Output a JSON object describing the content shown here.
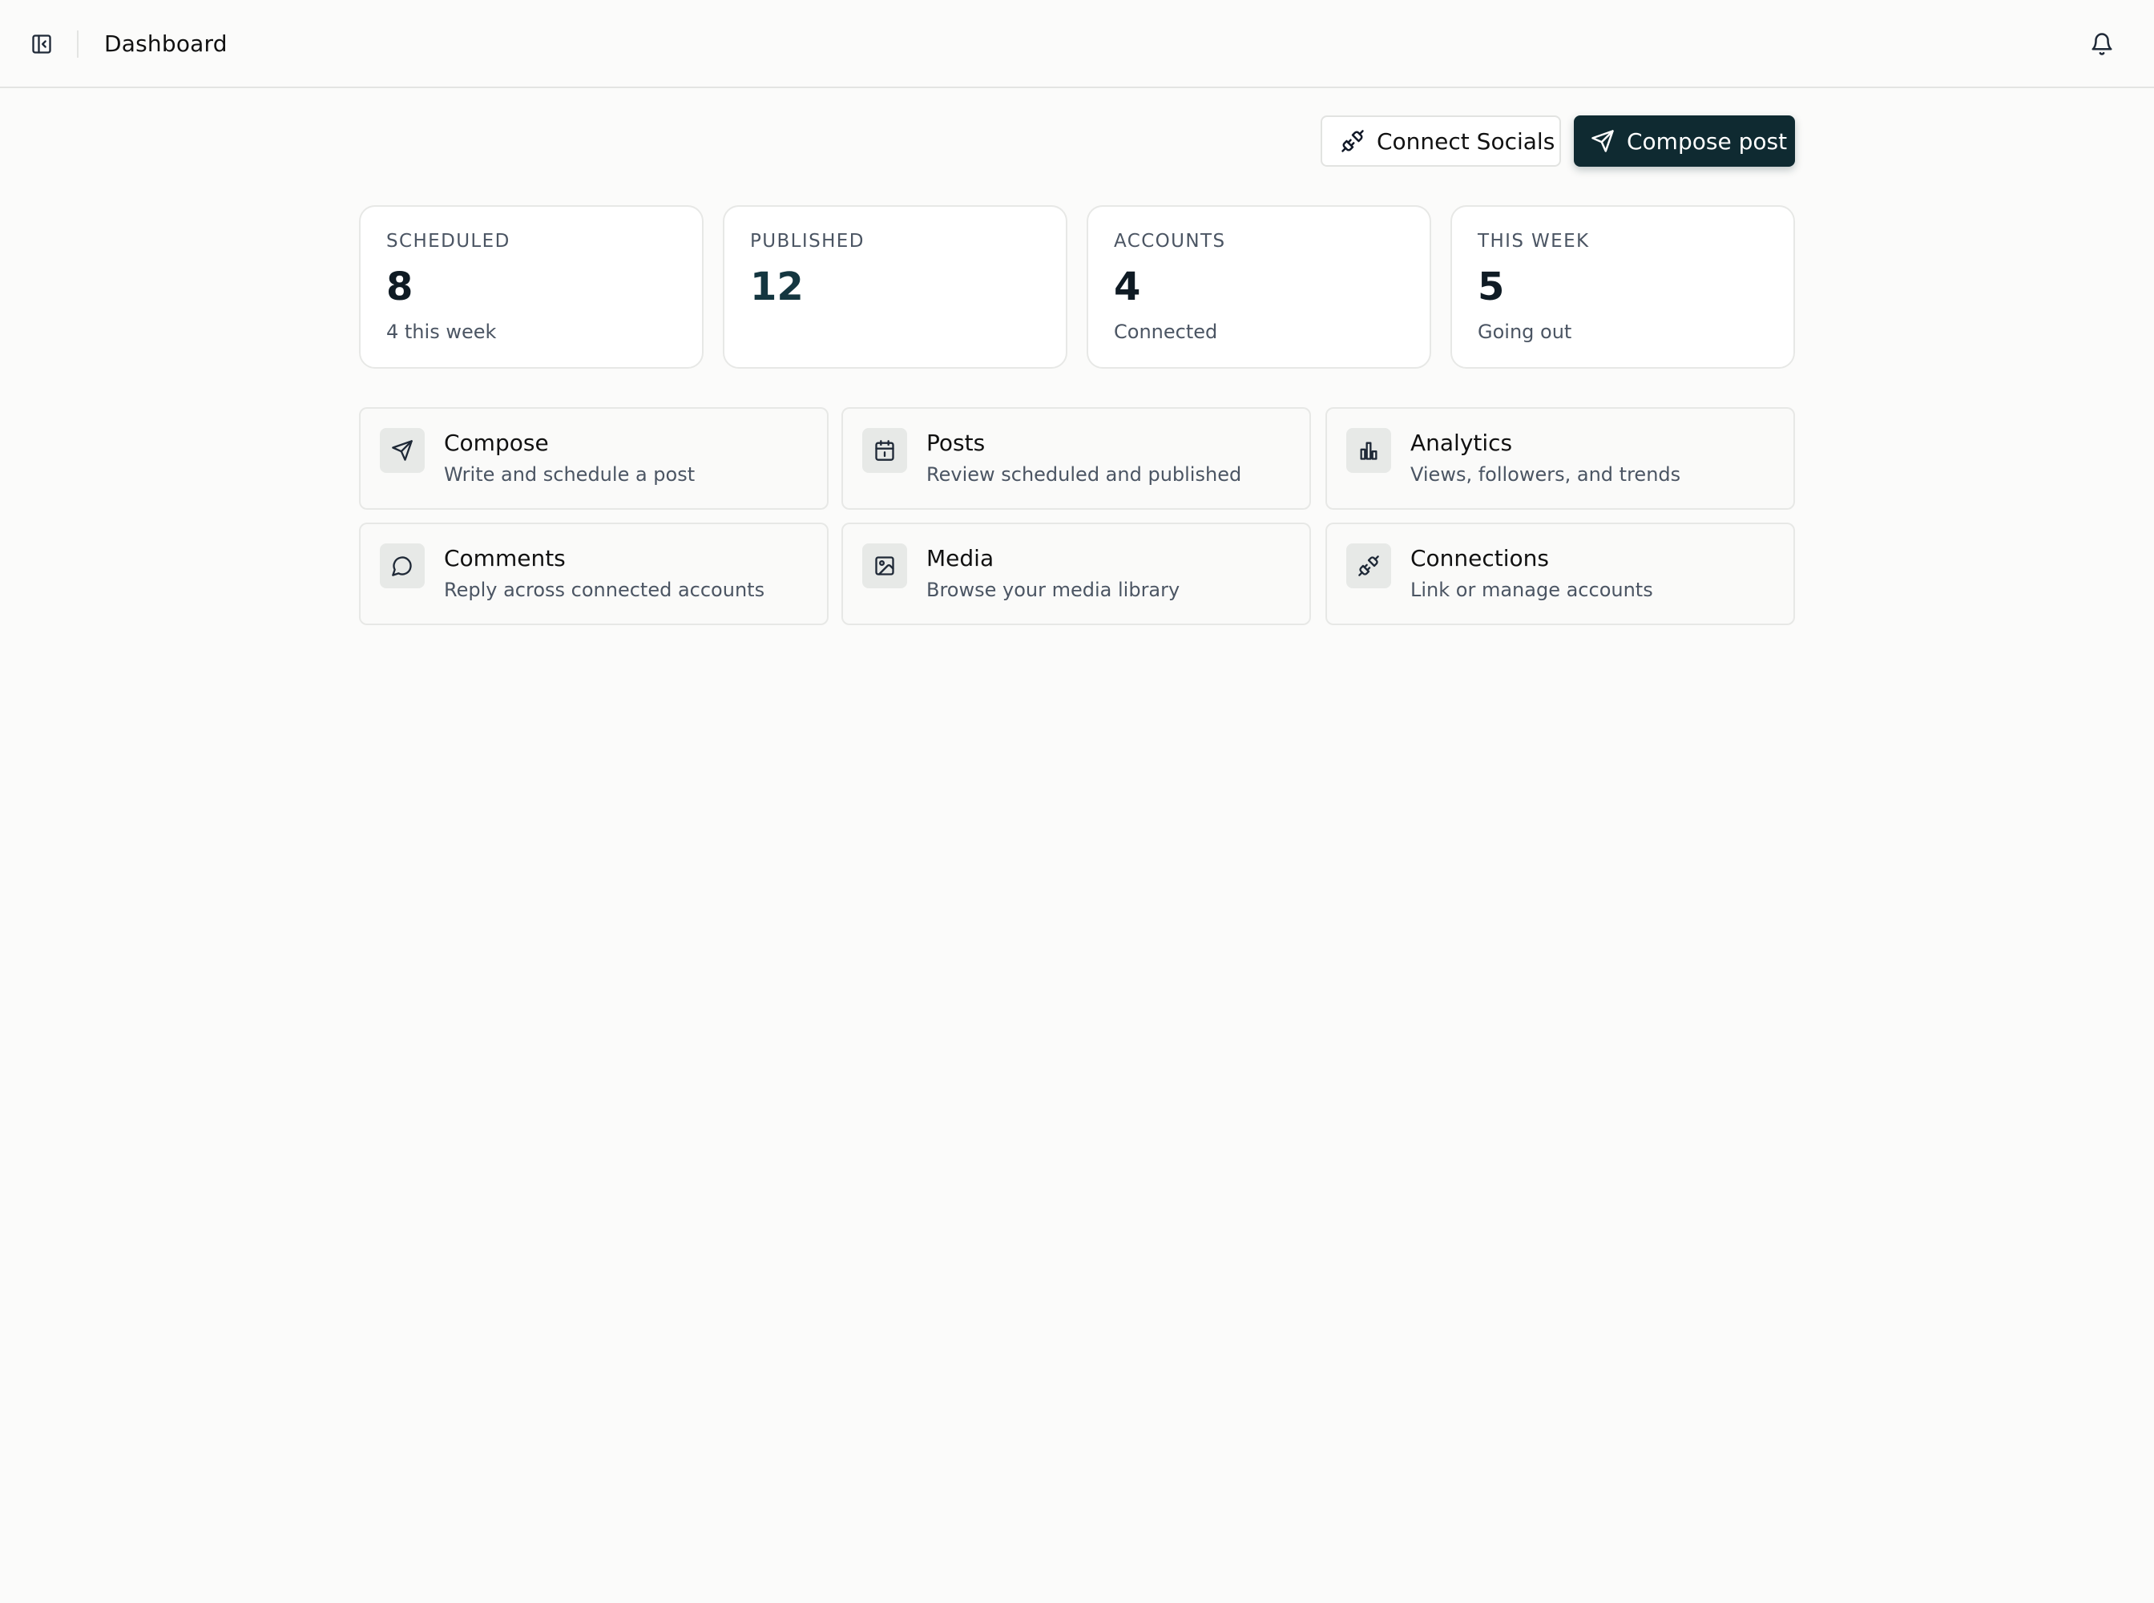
{
  "header": {
    "title": "Dashboard",
    "sidebar_toggle_icon": "sidebar-panel-icon",
    "notifications_icon": "bell-icon"
  },
  "actions": {
    "connect_label": "Connect Socials",
    "connect_icon": "plug-icon",
    "compose_label": "Compose post",
    "compose_icon": "send-icon",
    "primary_color": "#0f2a31"
  },
  "stats": [
    {
      "label": "SCHEDULED",
      "value": "8",
      "sub": "4 this week"
    },
    {
      "label": "PUBLISHED",
      "value": "12",
      "sub": ""
    },
    {
      "label": "ACCOUNTS",
      "value": "4",
      "sub": "Connected"
    },
    {
      "label": "THIS WEEK",
      "value": "5",
      "sub": "Going out"
    }
  ],
  "nav_cards": [
    {
      "title": "Compose",
      "desc": "Write and schedule a post",
      "icon": "send-icon"
    },
    {
      "title": "Posts",
      "desc": "Review scheduled and published",
      "icon": "calendar-icon"
    },
    {
      "title": "Analytics",
      "desc": "Views, followers, and trends",
      "icon": "bar-chart-icon"
    },
    {
      "title": "Comments",
      "desc": "Reply across connected accounts",
      "icon": "message-circle-icon"
    },
    {
      "title": "Media",
      "desc": "Browse your media library",
      "icon": "image-icon"
    },
    {
      "title": "Connections",
      "desc": "Link or manage accounts",
      "icon": "plug-icon"
    }
  ]
}
